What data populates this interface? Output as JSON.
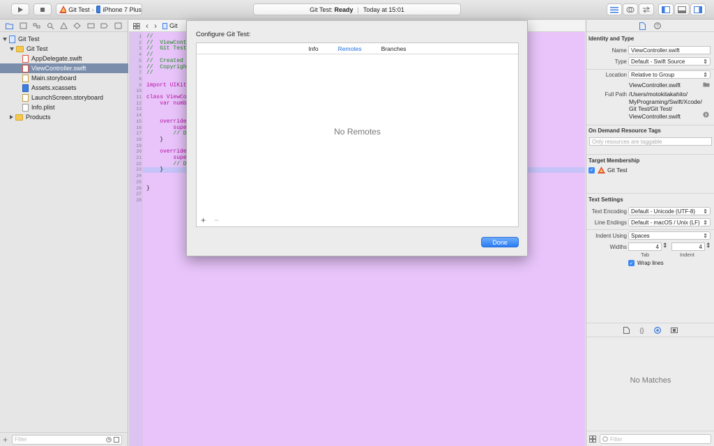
{
  "toolbar": {
    "scheme_project": "Git Test",
    "scheme_device": "iPhone 7 Plus",
    "status_project": "Git Test:",
    "status_state": "Ready",
    "status_time": "Today at 15:01"
  },
  "navigator": {
    "items": [
      {
        "label": "Git Test",
        "kind": "project"
      },
      {
        "label": "Git Test",
        "kind": "folder"
      },
      {
        "label": "AppDelegate.swift",
        "kind": "file"
      },
      {
        "label": "ViewController.swift",
        "kind": "file"
      },
      {
        "label": "Main.storyboard",
        "kind": "file"
      },
      {
        "label": "Assets.xcassets",
        "kind": "file"
      },
      {
        "label": "LaunchScreen.storyboard",
        "kind": "file"
      },
      {
        "label": "Info.plist",
        "kind": "file"
      },
      {
        "label": "Products",
        "kind": "folder"
      }
    ],
    "filter_placeholder": "Filter"
  },
  "editor": {
    "jump_project": "Git",
    "code_lines": [
      {
        "n": "1",
        "text": "//",
        "cls": "cm"
      },
      {
        "n": "2",
        "text": "//  ViewCont",
        "cls": "cm"
      },
      {
        "n": "3",
        "text": "//  Git Test",
        "cls": "cm"
      },
      {
        "n": "4",
        "text": "//",
        "cls": "cm"
      },
      {
        "n": "5",
        "text": "//  Created",
        "cls": "cm"
      },
      {
        "n": "6",
        "text": "//  Copyrigh",
        "cls": "cm"
      },
      {
        "n": "7",
        "text": "//",
        "cls": "cm"
      },
      {
        "n": "8",
        "text": "",
        "cls": ""
      },
      {
        "n": "9",
        "text": "import UIKit",
        "cls": "kw"
      },
      {
        "n": "10",
        "text": "",
        "cls": ""
      },
      {
        "n": "11",
        "text": "class ViewCo",
        "cls": "kw"
      },
      {
        "n": "12",
        "text": "    var numb",
        "cls": "kw"
      },
      {
        "n": "13",
        "text": "",
        "cls": ""
      },
      {
        "n": "14",
        "text": "",
        "cls": ""
      },
      {
        "n": "15",
        "text": "    override",
        "cls": "kw"
      },
      {
        "n": "16",
        "text": "        supe",
        "cls": "kw"
      },
      {
        "n": "17",
        "text": "        // D",
        "cls": "cm"
      },
      {
        "n": "18",
        "text": "    }",
        "cls": ""
      },
      {
        "n": "19",
        "text": "",
        "cls": ""
      },
      {
        "n": "20",
        "text": "    override",
        "cls": "kw"
      },
      {
        "n": "21",
        "text": "        supe",
        "cls": "kw"
      },
      {
        "n": "22",
        "text": "        // D",
        "cls": "cm"
      },
      {
        "n": "23",
        "text": "    }",
        "cls": ""
      },
      {
        "n": "24",
        "text": "",
        "cls": ""
      },
      {
        "n": "25",
        "text": "",
        "cls": ""
      },
      {
        "n": "26",
        "text": "}",
        "cls": ""
      },
      {
        "n": "27",
        "text": "",
        "cls": ""
      },
      {
        "n": "28",
        "text": "",
        "cls": ""
      }
    ]
  },
  "dialog": {
    "title": "Configure Git Test:",
    "tabs": [
      "Info",
      "Remotes",
      "Branches"
    ],
    "active_tab": "Remotes",
    "empty_text": "No Remotes",
    "add_label": "+",
    "remove_label": "−",
    "done_label": "Done"
  },
  "inspector": {
    "identity_title": "Identity and Type",
    "name_label": "Name",
    "name_value": "ViewController.swift",
    "type_label": "Type",
    "type_value": "Default - Swift Source",
    "location_label": "Location",
    "location_value": "Relative to Group",
    "location_file": "ViewController.swift",
    "fullpath_label": "Full Path",
    "fullpath_lines": [
      "/Users/motokitakahito/",
      "MyPrograming/Swift/Xcode/",
      "Git Test/Git Test/",
      "ViewController.swift"
    ],
    "odr_title": "On Demand Resource Tags",
    "odr_placeholder": "Only resources are taggable",
    "target_title": "Target Membership",
    "target_name": "Git Test",
    "text_settings_title": "Text Settings",
    "encoding_label": "Text Encoding",
    "encoding_value": "Default - Unicode (UTF-8)",
    "line_endings_label": "Line Endings",
    "line_endings_value": "Default - macOS / Unix (LF)",
    "indent_using_label": "Indent Using",
    "indent_using_value": "Spaces",
    "widths_label": "Widths",
    "tab_value": "4",
    "indent_value": "4",
    "tab_caption": "Tab",
    "indent_caption": "Indent",
    "wrap_label": "Wrap lines",
    "library_empty": "No Matches",
    "filter_placeholder": "Filter"
  }
}
